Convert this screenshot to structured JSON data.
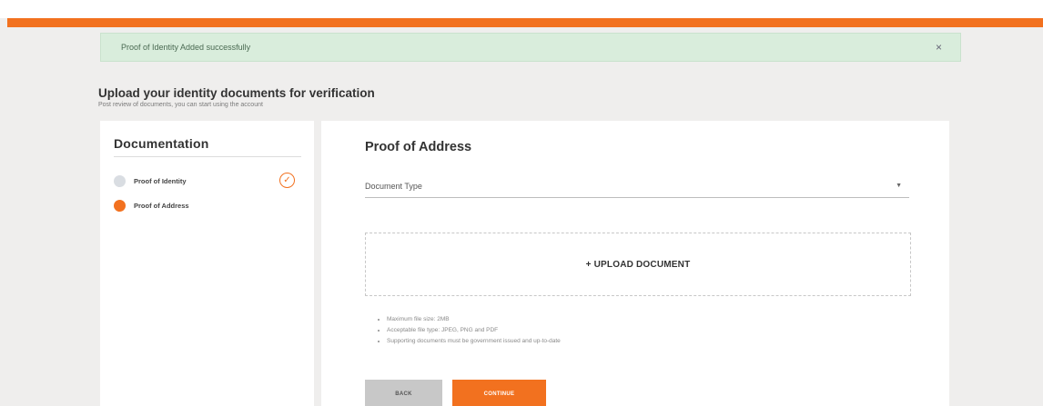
{
  "colors": {
    "accent": "#f2711f",
    "alert_bg": "#d9eddc"
  },
  "alert": {
    "message": "Proof of Identity Added successfully",
    "close_icon": "close-icon",
    "close_symbol": "×"
  },
  "header": {
    "title": "Upload your identity documents for verification",
    "subtitle": "Post review of documents, you can start using the account"
  },
  "sidebar": {
    "title": "Documentation",
    "steps": [
      {
        "label": "Proof of Identity",
        "status": "completed"
      },
      {
        "label": "Proof of Address",
        "status": "active"
      }
    ],
    "check_symbol": "✓"
  },
  "main": {
    "title": "Proof of Address",
    "document_type": {
      "value": "Document Type",
      "caret": "▼"
    },
    "upload_label": "+ UPLOAD DOCUMENT",
    "notes": [
      "Maximum file size: 2MB",
      "Acceptable file type: JPEG, PNG and PDF",
      "Supporting documents must be government issued and up-to-date"
    ],
    "back_label": "BACK",
    "continue_label": "CONTINUE"
  }
}
